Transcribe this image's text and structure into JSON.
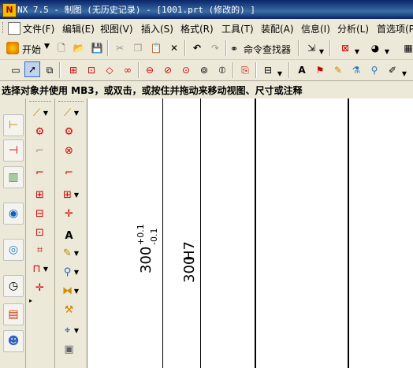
{
  "titlebar": {
    "title": "NX 7.5 - 制图 (无历史记录) - [1001.prt (修改的) ]"
  },
  "menubar": {
    "items": [
      "文件(F)",
      "编辑(E)",
      "视图(V)",
      "插入(S)",
      "格式(R)",
      "工具(T)",
      "装配(A)",
      "信息(I)",
      "分析(L)",
      "首选项(P)"
    ]
  },
  "toolbar1": {
    "start_label": "开始",
    "command_finder_label": "命令查找器"
  },
  "hint": {
    "text": "选择对象并使用 MB3，或双击，或按住并拖动来移动视图、尺寸或注释"
  },
  "drawing": {
    "dim1_value": "300",
    "dim1_tol_upper": "+0.1",
    "dim1_tol_lower": "-0.1",
    "dim2_value": "300",
    "dim2_fit": "H7"
  },
  "icons": {
    "palette0": [
      "part-navigator-icon",
      "assembly-navigator-icon",
      "reuse-library-icon",
      "web-browser-icon",
      "history-icon",
      "clock-icon",
      "visualization-icon",
      "roles-icon"
    ],
    "palette1": [
      "dimension-style-icon",
      "view-style-icon",
      "blank-view-icon",
      "base-view-icon",
      "projected-view-icon",
      "section-view-icon",
      "detail-view-icon",
      "break-view-icon",
      "break-detail-icon",
      "centerline-icon"
    ],
    "palette2": [
      "dimension-icon",
      "feature-control-icon",
      "view-label-icon",
      "base-view2-icon",
      "axis-icon",
      "note-icon",
      "hatch-icon",
      "ordinate-icon",
      "weld-icon",
      "surface-finish-icon",
      "target-point-icon",
      "image-icon"
    ]
  }
}
